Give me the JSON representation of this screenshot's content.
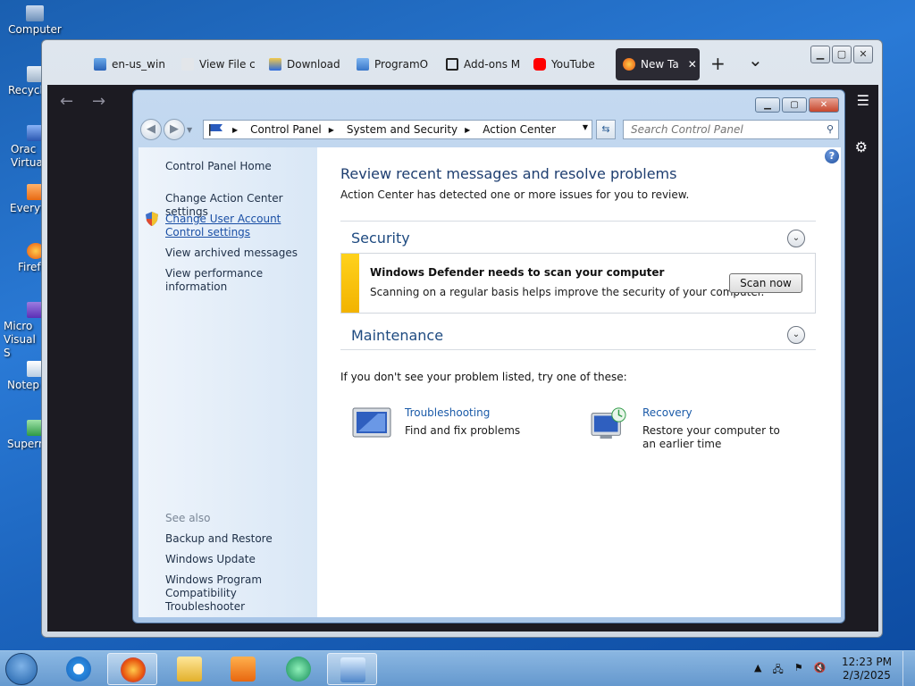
{
  "desktop": {
    "icons": [
      {
        "label": "Computer"
      },
      {
        "label": "Recycl"
      },
      {
        "label": "Orac Virtua"
      },
      {
        "label": "Everyt"
      },
      {
        "label": "Firef"
      },
      {
        "label": "Micro Visual S"
      },
      {
        "label": "Notep"
      },
      {
        "label": "Supern"
      }
    ]
  },
  "browser": {
    "tabs": [
      {
        "label": "en-us_win"
      },
      {
        "label": "View File c"
      },
      {
        "label": "Download"
      },
      {
        "label": "ProgramO"
      },
      {
        "label": "Add-ons M"
      },
      {
        "label": "YouTube"
      },
      {
        "label": "New Ta"
      }
    ],
    "new_tab_symbol": "+",
    "list_all_tabs_symbol": "⌄",
    "close_tab_symbol": "✕"
  },
  "control_panel": {
    "breadcrumb": [
      "Control Panel",
      "System and Security",
      "Action Center"
    ],
    "search_placeholder": "Search Control Panel",
    "sidebar": {
      "home": "Control Panel Home",
      "links": [
        "Change Action Center settings",
        "Change User Account Control settings",
        "View archived messages",
        "View performance information"
      ],
      "see_also_title": "See also",
      "see_also": [
        "Backup and Restore",
        "Windows Update",
        "Windows Program Compatibility Troubleshooter"
      ]
    },
    "main": {
      "title": "Review recent messages and resolve problems",
      "subtitle": "Action Center has detected one or more issues for you to review.",
      "security": {
        "heading": "Security",
        "alert_title": "Windows Defender needs to scan your computer",
        "alert_desc": "Scanning on a regular basis helps improve the security of your computer.",
        "button": "Scan now"
      },
      "maintenance": {
        "heading": "Maintenance"
      },
      "hint": "If you don't see your problem listed, try one of these:",
      "tools": [
        {
          "link": "Troubleshooting",
          "desc": "Find and fix problems"
        },
        {
          "link": "Recovery",
          "desc": "Restore your computer to an earlier time"
        }
      ]
    }
  },
  "taskbar": {
    "time": "12:23 PM",
    "date": "2/3/2025"
  },
  "colors": {
    "accent_link": "#1a5aa8",
    "alert_yellow": "#f2b300",
    "heading_blue": "#1e3e70"
  }
}
